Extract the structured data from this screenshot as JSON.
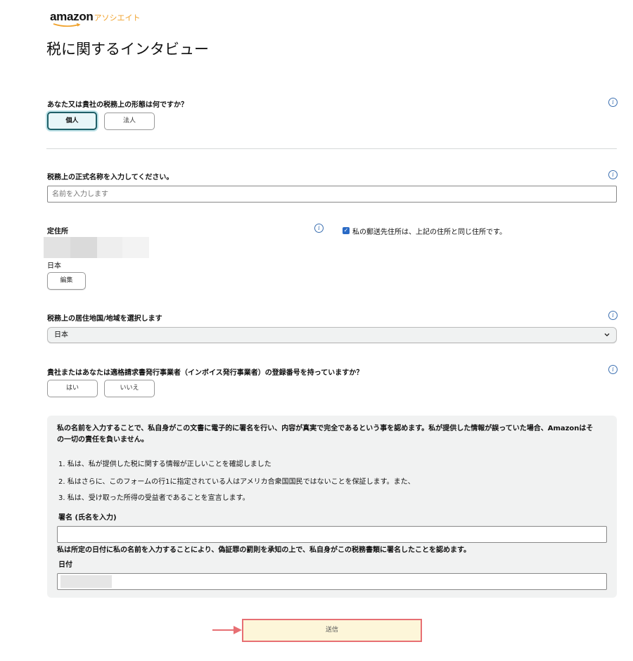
{
  "brand": {
    "logo_main": "amazon",
    "logo_sub": "アソシエイト"
  },
  "page": {
    "title": "税に関するインタビュー"
  },
  "tax_form_question": {
    "label": "あなた又は貴社の税務上の形態は何ですか？",
    "options": [
      "個人",
      "法人"
    ],
    "selected": "個人"
  },
  "legal_name": {
    "label": "税務上の正式名称を入力してください。",
    "placeholder": "名前を入力します",
    "value": ""
  },
  "address": {
    "label": "定住所",
    "country": "日本",
    "edit_label": "編集",
    "mailing_same_label": "私の郵送先住所は、上記の住所と同じ住所です。",
    "mailing_same_checked": true
  },
  "residence": {
    "label": "税務上の居住地国/地域を選択します",
    "selected": "日本"
  },
  "invoice": {
    "label": "貴社またはあなたは適格請求書発行事業者（インボイス発行事業者）の登録番号を持っていますか？",
    "options": [
      "はい",
      "いいえ"
    ]
  },
  "declaration": {
    "intro": "私の名前を入力することで、私自身がこの文書に電子的に署名を行い、内容が真実で完全であるという事を認めます。私が提供した情報が誤っていた場合、Amazonはその一切の責任を負いません。",
    "items": [
      "1. 私は、私が提供した税に関する情報が正しいことを確認しました",
      "2. 私はさらに、このフォームの行1に指定されている人はアメリカ合衆国国民ではないことを保証します。また、",
      "3. 私は、受け取った所得の受益者であることを宣言します。"
    ],
    "signature_label": "署名 (氏名を入力)",
    "signature_value": "",
    "signature_note": "私は所定の日付に私の名前を入力することにより、偽証罪の罰則を承知の上で、私自身がこの税務書類に署名したことを認めます。",
    "date_label": "日付"
  },
  "submit": {
    "label": "送信"
  },
  "colors": {
    "accent": "#1f5f67",
    "highlight_border": "#e76f73",
    "arrow": "#e76f73",
    "logo_orange": "#f0a22c"
  }
}
